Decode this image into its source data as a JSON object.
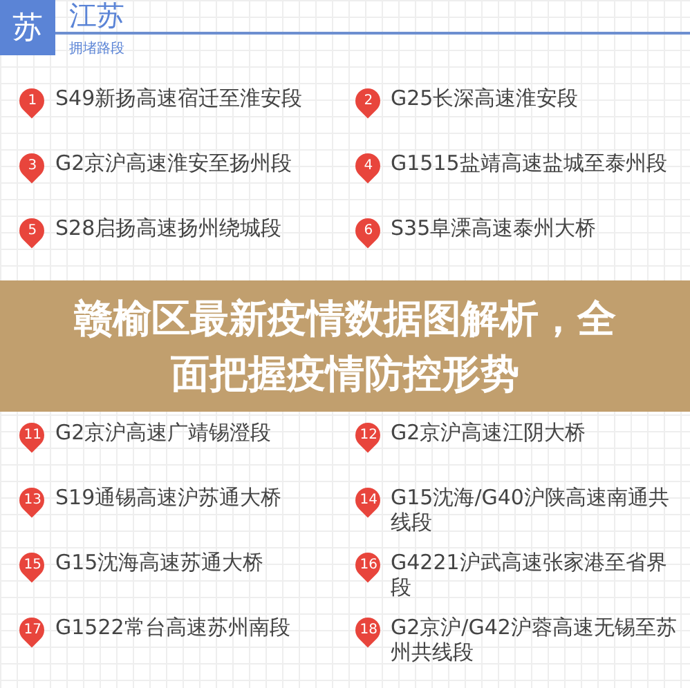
{
  "header": {
    "badge": "苏",
    "title": "江苏",
    "subtitle": "拥堵路段"
  },
  "items": [
    {
      "number": "1",
      "text": "S49新扬高速宿迁至淮安段"
    },
    {
      "number": "2",
      "text": "G25长深高速淮安段"
    },
    {
      "number": "3",
      "text": "G2京沪高速淮安至扬州段"
    },
    {
      "number": "4",
      "text": "G1515盐靖高速盐城至泰州段"
    },
    {
      "number": "5",
      "text": "S28启扬高速扬州绕城段"
    },
    {
      "number": "6",
      "text": "S35阜溧高速泰州大桥"
    }
  ],
  "items_lower": [
    {
      "number": "11",
      "text": "G2京沪高速广靖锡澄段"
    },
    {
      "number": "12",
      "text": "G2京沪高速江阴大桥"
    },
    {
      "number": "13",
      "text": "S19通锡高速沪苏通大桥"
    },
    {
      "number": "14",
      "text": "G15沈海/G40沪陕高速南通共线段"
    },
    {
      "number": "15",
      "text": "G15沈海高速苏通大桥"
    },
    {
      "number": "16",
      "text": "G4221沪武高速张家港至省界段"
    },
    {
      "number": "17",
      "text": "G1522常台高速苏州南段"
    },
    {
      "number": "18",
      "text": "G2京沪/G42沪蓉高速无锡至苏州共线段"
    }
  ],
  "banner": {
    "title": "赣榆区最新疫情数据图解析，全面把握疫情防控形势"
  }
}
